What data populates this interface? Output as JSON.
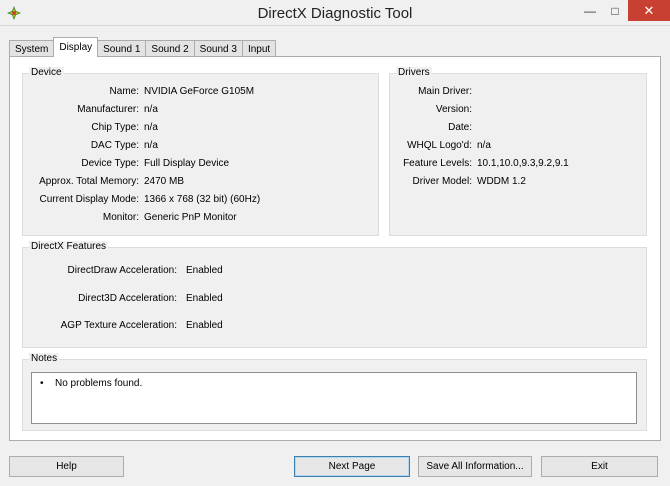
{
  "window": {
    "title": "DirectX Diagnostic Tool",
    "icon": "directx-icon",
    "min_glyph": "—",
    "max_glyph": "□",
    "close_glyph": "✕"
  },
  "tabs": [
    "System",
    "Display",
    "Sound 1",
    "Sound 2",
    "Sound 3",
    "Input"
  ],
  "active_tab": "Display",
  "device": {
    "title": "Device",
    "rows": [
      {
        "label": "Name:",
        "value": "NVIDIA GeForce G105M"
      },
      {
        "label": "Manufacturer:",
        "value": "n/a"
      },
      {
        "label": "Chip Type:",
        "value": "n/a"
      },
      {
        "label": "DAC Type:",
        "value": "n/a"
      },
      {
        "label": "Device Type:",
        "value": "Full Display Device"
      },
      {
        "label": "Approx. Total Memory:",
        "value": "2470 MB"
      },
      {
        "label": "Current Display Mode:",
        "value": "1366 x 768 (32 bit) (60Hz)"
      },
      {
        "label": "Monitor:",
        "value": "Generic PnP Monitor"
      }
    ]
  },
  "drivers": {
    "title": "Drivers",
    "rows": [
      {
        "label": "Main Driver:",
        "value": ""
      },
      {
        "label": "Version:",
        "value": ""
      },
      {
        "label": "Date:",
        "value": ""
      },
      {
        "label": "WHQL Logo'd:",
        "value": "n/a"
      },
      {
        "label": "Feature Levels:",
        "value": "10.1,10.0,9.3,9.2,9.1"
      },
      {
        "label": "Driver Model:",
        "value": "WDDM 1.2"
      }
    ]
  },
  "features": {
    "title": "DirectX Features",
    "rows": [
      {
        "label": "DirectDraw Acceleration:",
        "value": "Enabled"
      },
      {
        "label": "Direct3D Acceleration:",
        "value": "Enabled"
      },
      {
        "label": "AGP Texture Acceleration:",
        "value": "Enabled"
      }
    ]
  },
  "notes": {
    "title": "Notes",
    "bullet": "•",
    "text": "No problems found."
  },
  "buttons": {
    "help": "Help",
    "next_page": "Next Page",
    "save_all": "Save All Information...",
    "exit": "Exit"
  }
}
